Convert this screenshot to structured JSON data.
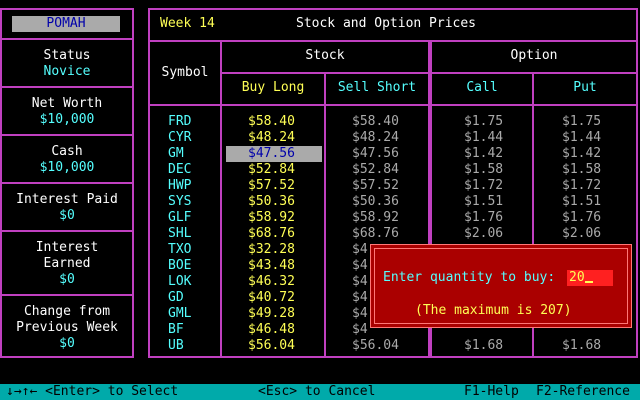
{
  "sidebar": {
    "player_name": "POMAH",
    "status_label": "Status",
    "status_value": "Novice",
    "net_worth_label": "Net Worth",
    "net_worth_value": "$10,000",
    "cash_label": "Cash",
    "cash_value": "$10,000",
    "interest_paid_label": "Interest Paid",
    "interest_paid_value": "$0",
    "interest_earned_label_1": "Interest",
    "interest_earned_label_2": "Earned",
    "interest_earned_value": "$0",
    "change_label_1": "Change from",
    "change_label_2": "Previous Week",
    "change_value": "$0"
  },
  "header": {
    "week": "Week 14",
    "title": "Stock and Option Prices"
  },
  "table": {
    "symbol_header": "Symbol",
    "stock_header": "Stock",
    "option_header": "Option",
    "buy_long_header": "Buy Long",
    "sell_short_header": "Sell Short",
    "call_header": "Call",
    "put_header": "Put",
    "rows": [
      {
        "symbol": "FRD",
        "buy": "$58.40",
        "sell": "$58.40",
        "call": "$1.75",
        "put": "$1.75"
      },
      {
        "symbol": "CYR",
        "buy": "$48.24",
        "sell": "$48.24",
        "call": "$1.44",
        "put": "$1.44"
      },
      {
        "symbol": "GM",
        "buy": "$47.56",
        "sell": "$47.56",
        "call": "$1.42",
        "put": "$1.42"
      },
      {
        "symbol": "DEC",
        "buy": "$52.84",
        "sell": "$52.84",
        "call": "$1.58",
        "put": "$1.58"
      },
      {
        "symbol": "HWP",
        "buy": "$57.52",
        "sell": "$57.52",
        "call": "$1.72",
        "put": "$1.72"
      },
      {
        "symbol": "SYS",
        "buy": "$50.36",
        "sell": "$50.36",
        "call": "$1.51",
        "put": "$1.51"
      },
      {
        "symbol": "GLF",
        "buy": "$58.92",
        "sell": "$58.92",
        "call": "$1.76",
        "put": "$1.76"
      },
      {
        "symbol": "SHL",
        "buy": "$68.76",
        "sell": "$68.76",
        "call": "$2.06",
        "put": "$2.06"
      },
      {
        "symbol": "TXO",
        "buy": "$32.28",
        "sell": "$4",
        "call": "",
        "put": ""
      },
      {
        "symbol": "BOE",
        "buy": "$43.48",
        "sell": "$4",
        "call": "",
        "put": ""
      },
      {
        "symbol": "LOK",
        "buy": "$46.32",
        "sell": "$4",
        "call": "",
        "put": ""
      },
      {
        "symbol": "GD",
        "buy": "$40.72",
        "sell": "$4",
        "call": "",
        "put": ""
      },
      {
        "symbol": "GML",
        "buy": "$49.28",
        "sell": "$4",
        "call": "",
        "put": ""
      },
      {
        "symbol": "BF",
        "buy": "$46.48",
        "sell": "$4",
        "call": "",
        "put": ""
      },
      {
        "symbol": "UB",
        "buy": "$56.04",
        "sell": "$56.04",
        "call": "$1.68",
        "put": "$1.68"
      }
    ]
  },
  "dialog": {
    "prompt": "Enter quantity to buy:",
    "value": "20",
    "note": "(The maximum is 207)"
  },
  "statusbar": {
    "select_hint": "↓→↑← <Enter> to Select",
    "cancel_hint": "<Esc> to Cancel",
    "help_hint": "F1-Help",
    "reference_hint": "F2-Reference"
  }
}
